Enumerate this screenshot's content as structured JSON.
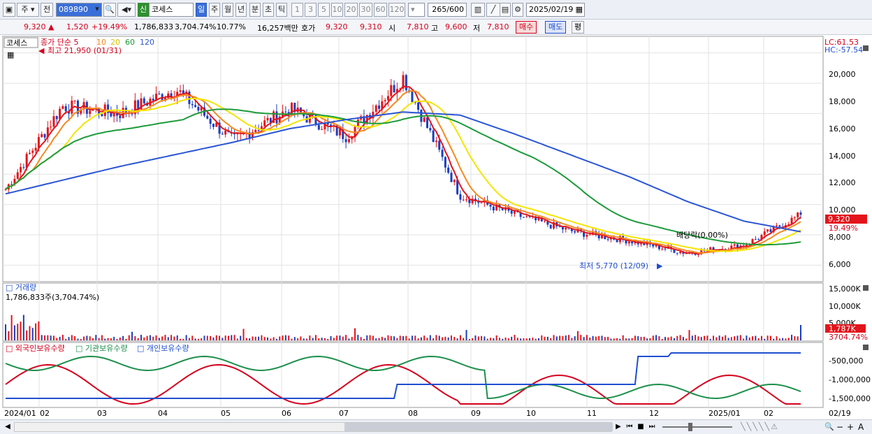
{
  "toolbar": {
    "type_label": "주",
    "period_label": "전",
    "code": "089890",
    "market_badge": "신",
    "stock_name": "코세스",
    "intervals": [
      "일",
      "주",
      "월",
      "년",
      "분",
      "초",
      "틱"
    ],
    "numbers": [
      "1",
      "3",
      "5",
      "10",
      "20",
      "30",
      "60",
      "120"
    ],
    "count": "265",
    "count_total": "/600",
    "date": "2025/02/19"
  },
  "quote": {
    "price": "9,320",
    "change": "1,520",
    "change_pct": "+19.49%",
    "volume": "1,786,833",
    "volume_pct": "3,704.74%",
    "turnover": "10.77%",
    "amount": "16,257백만",
    "ask_label": "호가",
    "ask1": "9,320",
    "ask2": "9,310",
    "open_label": "시",
    "open": "7,810",
    "high_label": "고",
    "high": "9,600",
    "low_label": "저",
    "low": "7,810",
    "buy_label": "매수",
    "sell_label": "매도",
    "avg_label": "평"
  },
  "main_chart": {
    "stock_tag": "코세스",
    "legend_prefix": "종가 단순 5",
    "ma_labels": [
      "10",
      "20",
      "60",
      "120"
    ],
    "ma_colors": [
      "#e0161e",
      "#f58a20",
      "#f4e500",
      "#1c9b3a",
      "#2a55d6"
    ],
    "high_note": "최고 21,950 (01/31)",
    "low_note": "최저 5,770 (12/09)",
    "dividend_note": "배당락(0.00%)",
    "lc": "LC:61.53",
    "hc": "HC:-57.54",
    "last_price": "9,320",
    "last_pct": "19.49%",
    "y_ticks": [
      "20,000",
      "18,000",
      "16,000",
      "14,000",
      "12,000",
      "10,000",
      "8,000",
      "6,000"
    ]
  },
  "volume_chart": {
    "title": "거래량",
    "current": "1,786,833주(3,704.74%)",
    "y_ticks": [
      "15,000K",
      "10,000K",
      "5,000K"
    ],
    "last_value": "1,787K",
    "last_pct": "3704.74%"
  },
  "holdings_chart": {
    "labels": [
      "외국인보유수량",
      "기관보유수량",
      "개인보유수량"
    ],
    "colors": [
      "#d6001c",
      "#1c8f4a",
      "#1f4fd0"
    ],
    "y_ticks": [
      "-500,000",
      "-1,000,000",
      "-1,500,000"
    ]
  },
  "x_axis": {
    "labels": [
      "2024/01",
      "02",
      "03",
      "04",
      "05",
      "06",
      "07",
      "08",
      "09",
      "10",
      "11",
      "12",
      "2025/01",
      "02"
    ],
    "last": "02/19"
  },
  "chart_data": {
    "type": "line",
    "x": [
      "2024/01",
      "02",
      "03",
      "04",
      "05",
      "06",
      "07",
      "08",
      "09",
      "10",
      "11",
      "12",
      "2025/01",
      "02/19"
    ],
    "series": [
      {
        "name": "종가",
        "values": [
          11000,
          16500,
          16000,
          17600,
          14200,
          16300,
          14500,
          18400,
          10600,
          9300,
          8200,
          7600,
          6800,
          7300,
          9320
        ]
      },
      {
        "name": "120",
        "values": [
          10700,
          11600,
          12500,
          13300,
          14100,
          15000,
          15600,
          16100,
          15900,
          14600,
          13200,
          11800,
          10200,
          8900,
          8200
        ]
      }
    ],
    "ylim": [
      5000,
      21000
    ]
  }
}
